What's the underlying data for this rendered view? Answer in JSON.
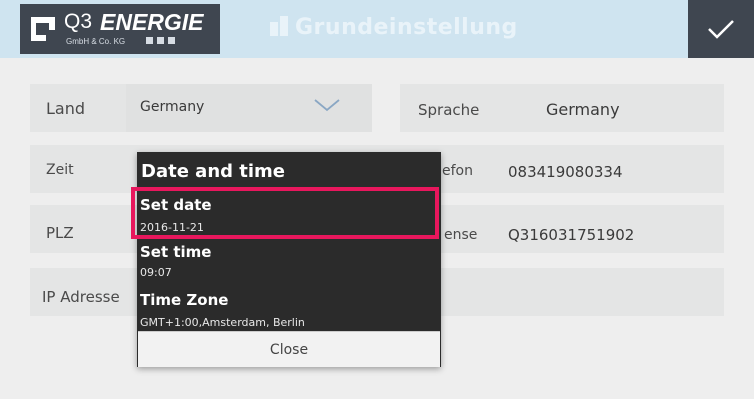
{
  "header": {
    "logo": {
      "brand_q3": "Q3",
      "brand_energie": "ENERGIE",
      "subline": "GmbH & Co. KG"
    },
    "title": "Grundeinstellung",
    "confirm_icon": "checkmark-icon"
  },
  "form": {
    "land": {
      "label": "Land",
      "value": "Germany"
    },
    "sprache": {
      "label": "Sprache",
      "value": "Germany"
    },
    "zeit": {
      "label": "Zeit"
    },
    "telefon": {
      "label_visible": "efon",
      "value": "083419080334"
    },
    "plz": {
      "label": "PLZ"
    },
    "lizenz": {
      "label_visible": "ense",
      "value": "Q316031751902"
    },
    "ip": {
      "label": "IP Adresse"
    }
  },
  "dialog": {
    "title": "Date and time",
    "items": [
      {
        "title": "Set date",
        "subtitle": "2016-11-21"
      },
      {
        "title": "Set time",
        "subtitle": "09:07"
      },
      {
        "title": "Time Zone",
        "subtitle": "GMT+1:00,Amsterdam, Berlin"
      }
    ],
    "close_label": "Close"
  },
  "colors": {
    "highlight": "#e8175d",
    "header_bg": "#cfe4f0",
    "dark": "#3f4650"
  }
}
